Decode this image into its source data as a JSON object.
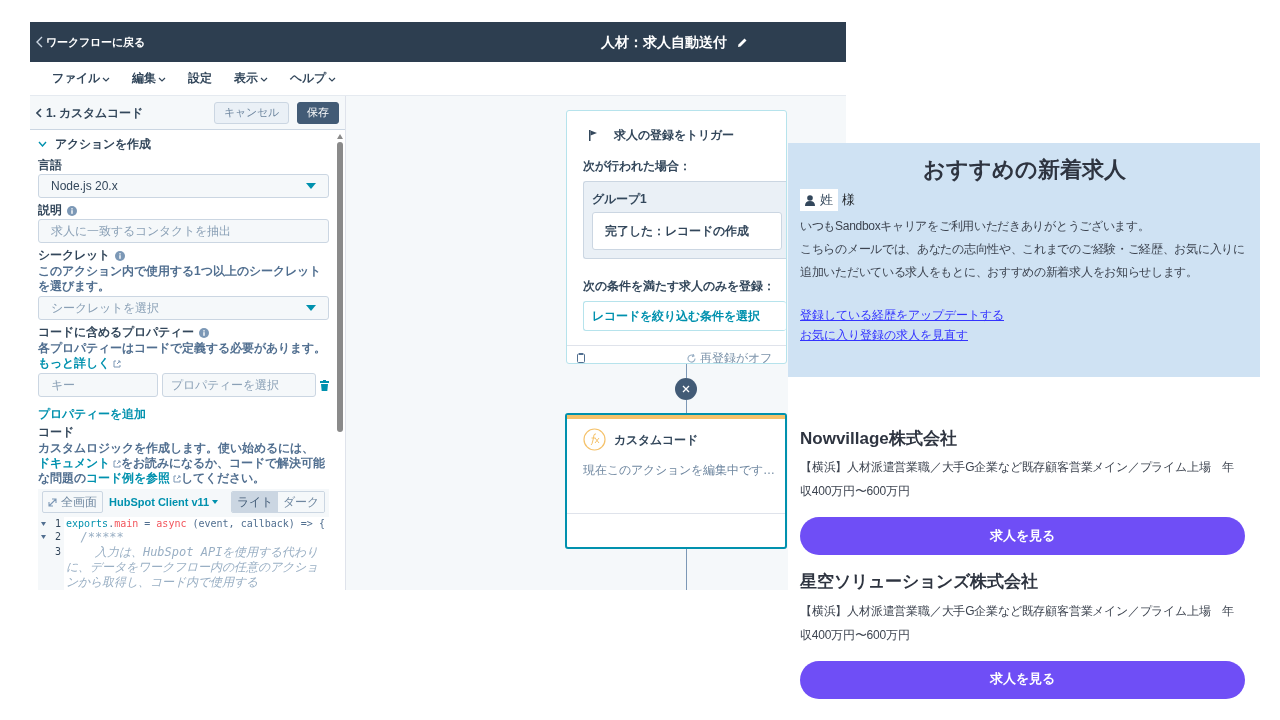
{
  "topbar": {
    "back_label": "ワークフローに戻る",
    "title": "人材：求人自動送付"
  },
  "menu": [
    {
      "label": "ファイル",
      "has_menu": true
    },
    {
      "label": "編集",
      "has_menu": true
    },
    {
      "label": "設定",
      "has_menu": false
    },
    {
      "label": "表示",
      "has_menu": true
    },
    {
      "label": "ヘルプ",
      "has_menu": true
    }
  ],
  "panel": {
    "title": "1. カスタムコード",
    "buttons": [
      {
        "label": "キャンセル",
        "kind": "secondary",
        "disabled": true
      },
      {
        "label": "保存",
        "kind": "primary",
        "disabled": false
      }
    ],
    "section": {
      "label": "アクションを作成",
      "expanded": true
    },
    "language": {
      "label": "言語",
      "value": "Node.js 20.x"
    },
    "description": {
      "label": "説明",
      "placeholder": "求人に一致するコンタクトを抽出"
    },
    "secret": {
      "label": "シークレット",
      "help": "このアクション内で使用する1つ以上のシークレットを選びます。",
      "placeholder": "シークレットを選択"
    },
    "properties": {
      "label": "コードに含めるプロパティー",
      "help": "各プロパティーはコードで定義する必要があります。",
      "help_link": "もっと詳しく",
      "key_placeholder": "キー",
      "property_placeholder": "プロパティーを選択",
      "add_label": "プロパティーを追加"
    },
    "code": {
      "label": "コード",
      "help_parts": [
        {
          "text": "カスタムロジックを作成します。使い始めるには、",
          "link": false
        },
        {
          "text": "ドキュメント",
          "link": true
        },
        {
          "text": "をお読みになるか、コードで解決可能な問題の",
          "link": false
        },
        {
          "text": "コード例を参照",
          "link": true
        },
        {
          "text": "してください。",
          "link": false
        }
      ]
    },
    "editor": {
      "fullscreen_label": "全画面",
      "client_label": "HubSpot Client v11",
      "themes": [
        {
          "label": "ライト",
          "selected": true
        },
        {
          "label": "ダーク",
          "selected": false
        }
      ],
      "lines": [
        {
          "number": "1",
          "foldable": true,
          "tokens": [
            {
              "text": "exports",
              "kind": "name"
            },
            {
              "text": ".",
              "kind": "plain"
            },
            {
              "text": "main",
              "kind": "keyword"
            },
            {
              "text": " = ",
              "kind": "plain"
            },
            {
              "text": "async",
              "kind": "keyword"
            },
            {
              "text": " (event, callback) => {",
              "kind": "plain"
            }
          ]
        },
        {
          "number": "2",
          "foldable": true,
          "tokens": [
            {
              "text": "  /*****",
              "kind": "comment"
            }
          ]
        },
        {
          "number": "3",
          "foldable": false,
          "tokens": [
            {
              "text": "    入力は、HubSpot APIを使用する代わりに、データをワークフロー内の任意のアクションから取得し、コード内で使用する",
              "kind": "comment"
            }
          ]
        }
      ]
    }
  },
  "canvas": {
    "trigger": {
      "title": "求人の登録をトリガー",
      "when_label": "次が行われた場合：",
      "group_title": "グループ1",
      "condition": "完了した：レコードの作成",
      "filter_label": "次の条件を満たす求人のみを登録：",
      "filter_link": "レコードを絞り込む条件を選択",
      "reenroll": "再登録がオフ",
      "selected": false
    },
    "action": {
      "title": "カスタムコード",
      "status": "現在このアクションを編集中です…",
      "selected": true
    }
  },
  "email": {
    "title": "おすすめの新着求人",
    "name_token": "姓",
    "honorific": "様",
    "paragraphs": [
      "いつもSandboxキャリアをご利用いただきありがとうございます。",
      "こちらのメールでは、あなたの志向性や、これまでのご経験・ご経歴、お気に入りに追加いただいている求人をもとに、おすすめの新着求人をお知らせします。"
    ],
    "links": [
      "登録している経歴をアップデートする",
      "お気に入り登録の求人を見直す"
    ],
    "jobs": [
      {
        "company": "Nowvillage株式会社",
        "description": "【横浜】人材派遣営業職／大手G企業など既存顧客営業メイン／プライム上場　年収400万円〜600万円",
        "button": "求人を見る"
      },
      {
        "company": "星空ソリューションズ株式会社",
        "description": "【横浜】人材派遣営業職／大手G企業など既存顧客営業メイン／プライム上場　年収400万円〜600万円",
        "button": "求人を見る"
      }
    ]
  }
}
